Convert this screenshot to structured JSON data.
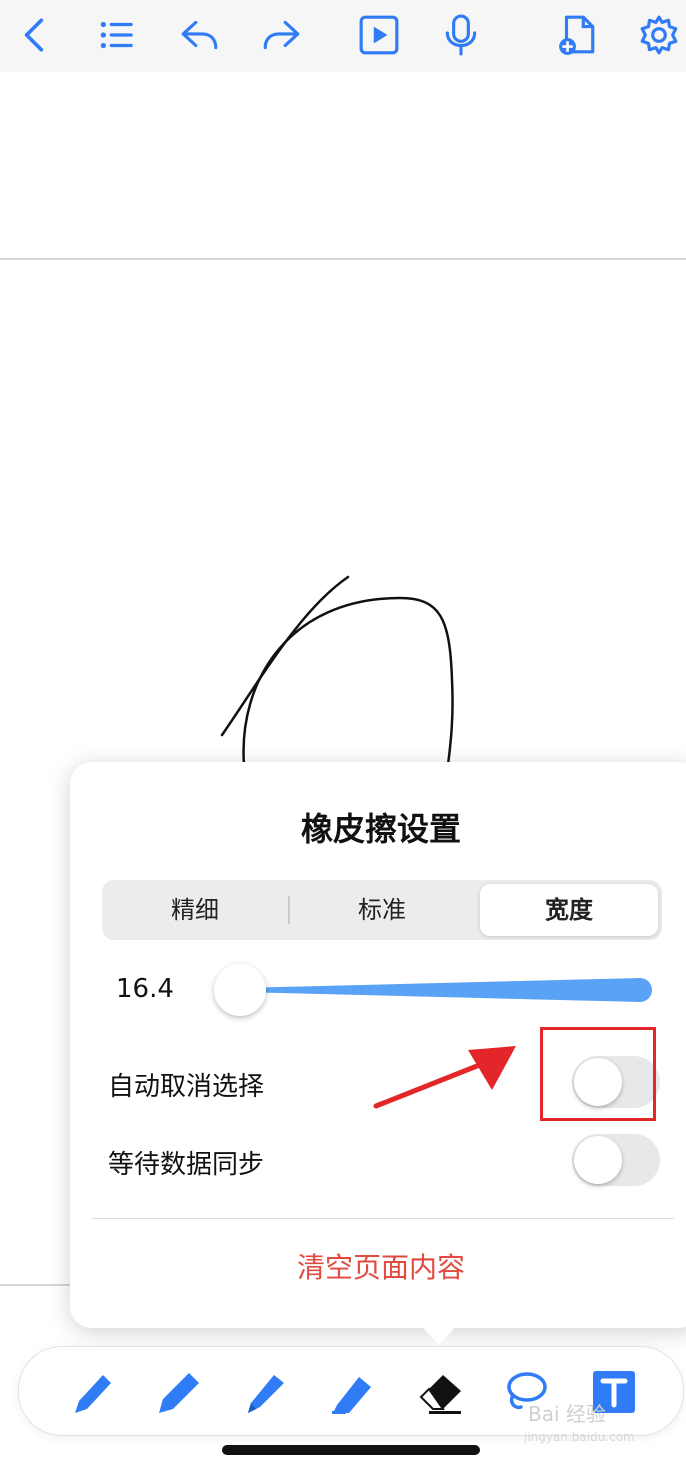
{
  "toolbar_top": {
    "icons": [
      "chevron-left-icon",
      "list-icon",
      "undo-icon",
      "redo-icon",
      "play-icon",
      "microphone-icon",
      "add-page-icon",
      "gear-icon"
    ]
  },
  "eraser_settings": {
    "title": "橡皮擦设置",
    "modes": [
      {
        "label": "精细",
        "active": false
      },
      {
        "label": "标准",
        "active": false
      },
      {
        "label": "宽度",
        "active": true
      }
    ],
    "width_value": "16.4",
    "options": [
      {
        "label": "自动取消选择",
        "enabled": false
      },
      {
        "label": "等待数据同步",
        "enabled": false
      }
    ],
    "clear_label": "清空页面内容"
  },
  "bottom_tools": [
    "pen-icon",
    "pen-icon",
    "pen-icon",
    "highlighter-icon",
    "eraser-icon",
    "lasso-icon",
    "text-icon"
  ],
  "watermark": {
    "text": "Bai 经验",
    "sub": "jingyan.baidu.com"
  },
  "colors": {
    "accent": "#2f7cf6",
    "danger": "#e14a3f",
    "annotation": "#e3262a"
  }
}
